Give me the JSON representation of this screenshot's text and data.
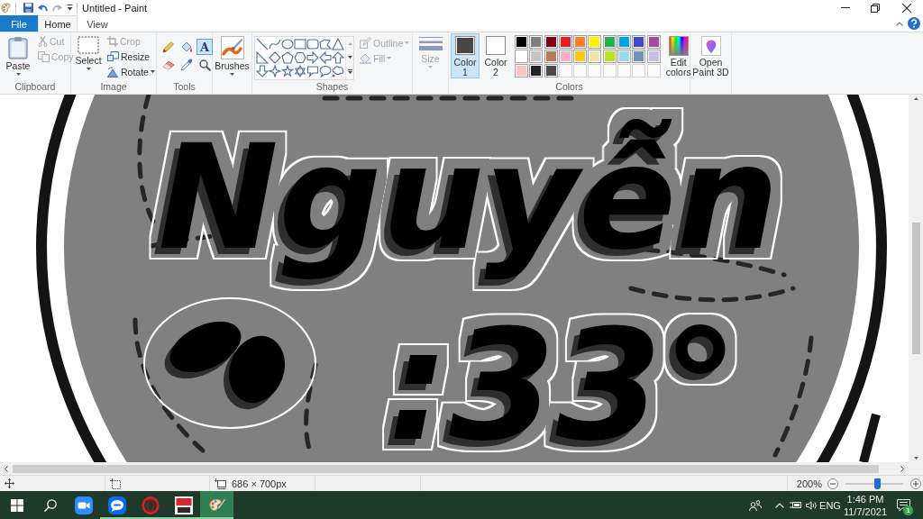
{
  "title_bar": {
    "title": "Untitled - Paint"
  },
  "tabs": [
    {
      "label": "File",
      "kind": "menu",
      "selected": false
    },
    {
      "label": "Home",
      "kind": "tab",
      "selected": true
    },
    {
      "label": "View",
      "kind": "tab",
      "selected": false
    }
  ],
  "ribbon": {
    "clipboard": {
      "label": "Clipboard",
      "paste": "Paste",
      "actions": [
        {
          "label": "Cut",
          "kind": "cut",
          "disabled": true
        },
        {
          "label": "Copy",
          "kind": "copy",
          "disabled": true
        }
      ]
    },
    "image": {
      "label": "Image",
      "select": "Select",
      "actions": [
        {
          "label": "Crop",
          "kind": "crop",
          "disabled": true
        },
        {
          "label": "Resize",
          "kind": "resize",
          "disabled": false
        },
        {
          "label": "Rotate",
          "kind": "rotate",
          "disabled": false
        }
      ]
    },
    "tools": {
      "label": "Tools",
      "items": [
        {
          "kind": "pencil",
          "selected": false
        },
        {
          "kind": "fill",
          "selected": false
        },
        {
          "kind": "text",
          "glyph": "A",
          "selected": true
        },
        {
          "kind": "eraser",
          "selected": false
        },
        {
          "kind": "picker",
          "selected": false
        },
        {
          "kind": "magnifier",
          "selected": false
        }
      ]
    },
    "brushes": {
      "button": "Brushes"
    },
    "shapes": {
      "label": "Shapes",
      "options": [
        {
          "label": "Outline",
          "kind": "outline",
          "disabled": true
        },
        {
          "label": "Fill",
          "kind": "fill",
          "disabled": true
        }
      ]
    },
    "size": {
      "button": "Size",
      "disabled": true
    },
    "colors": {
      "label": "Colors",
      "slots": [
        {
          "label": "Color 1",
          "color": "#474747",
          "selected": true
        },
        {
          "label": "Color 2",
          "color": "#ffffff",
          "selected": false
        }
      ],
      "palette": [
        {
          "kind": "color",
          "color": "#000000"
        },
        {
          "kind": "color",
          "color": "#7f7f7f"
        },
        {
          "kind": "color",
          "color": "#880015"
        },
        {
          "kind": "color",
          "color": "#ed1c24"
        },
        {
          "kind": "color",
          "color": "#ff7f27"
        },
        {
          "kind": "color",
          "color": "#fff200"
        },
        {
          "kind": "color",
          "color": "#22b14c"
        },
        {
          "kind": "color",
          "color": "#00a2e8"
        },
        {
          "kind": "color",
          "color": "#3f48cc"
        },
        {
          "kind": "color",
          "color": "#a349a4"
        },
        {
          "kind": "color",
          "color": "#ffffff"
        },
        {
          "kind": "color",
          "color": "#c3c3c3"
        },
        {
          "kind": "color",
          "color": "#b97a57"
        },
        {
          "kind": "color",
          "color": "#ffaec9"
        },
        {
          "kind": "color",
          "color": "#ffc90e"
        },
        {
          "kind": "color",
          "color": "#efe4b0"
        },
        {
          "kind": "color",
          "color": "#b5e61d"
        },
        {
          "kind": "color",
          "color": "#99d9ea"
        },
        {
          "kind": "color",
          "color": "#7092be"
        },
        {
          "kind": "color",
          "color": "#c8bfe7"
        },
        {
          "kind": "color",
          "color": "#ffc3c3"
        },
        {
          "kind": "color",
          "color": "#232323"
        },
        {
          "kind": "color",
          "color": "#4a4a4a"
        },
        {
          "kind": "empty"
        },
        {
          "kind": "empty"
        },
        {
          "kind": "empty"
        },
        {
          "kind": "empty"
        },
        {
          "kind": "empty"
        },
        {
          "kind": "empty"
        },
        {
          "kind": "empty"
        }
      ],
      "edit": "Edit colors"
    },
    "paint3d": {
      "button": "Open Paint 3D"
    }
  },
  "canvas": {
    "lettering": [
      {
        "text": "Nguyễn"
      },
      {
        "text": ":33°"
      }
    ]
  },
  "status_bar": {
    "image_size": "686 × 700px",
    "zoom": "200%",
    "zoom_slider": {
      "level": 0.55
    }
  },
  "taskbar": {
    "apps": [
      {
        "kind": "video",
        "running": false,
        "active": false
      },
      {
        "kind": "chat",
        "running": true,
        "active": false
      },
      {
        "kind": "ring",
        "running": true,
        "active": false
      },
      {
        "kind": "tile",
        "running": true,
        "active": false
      },
      {
        "kind": "paint",
        "running": true,
        "active": true
      }
    ],
    "tray": {
      "language": "ENG",
      "time": "1:46 PM",
      "date": "11/7/2021",
      "notification_count": "1"
    }
  }
}
